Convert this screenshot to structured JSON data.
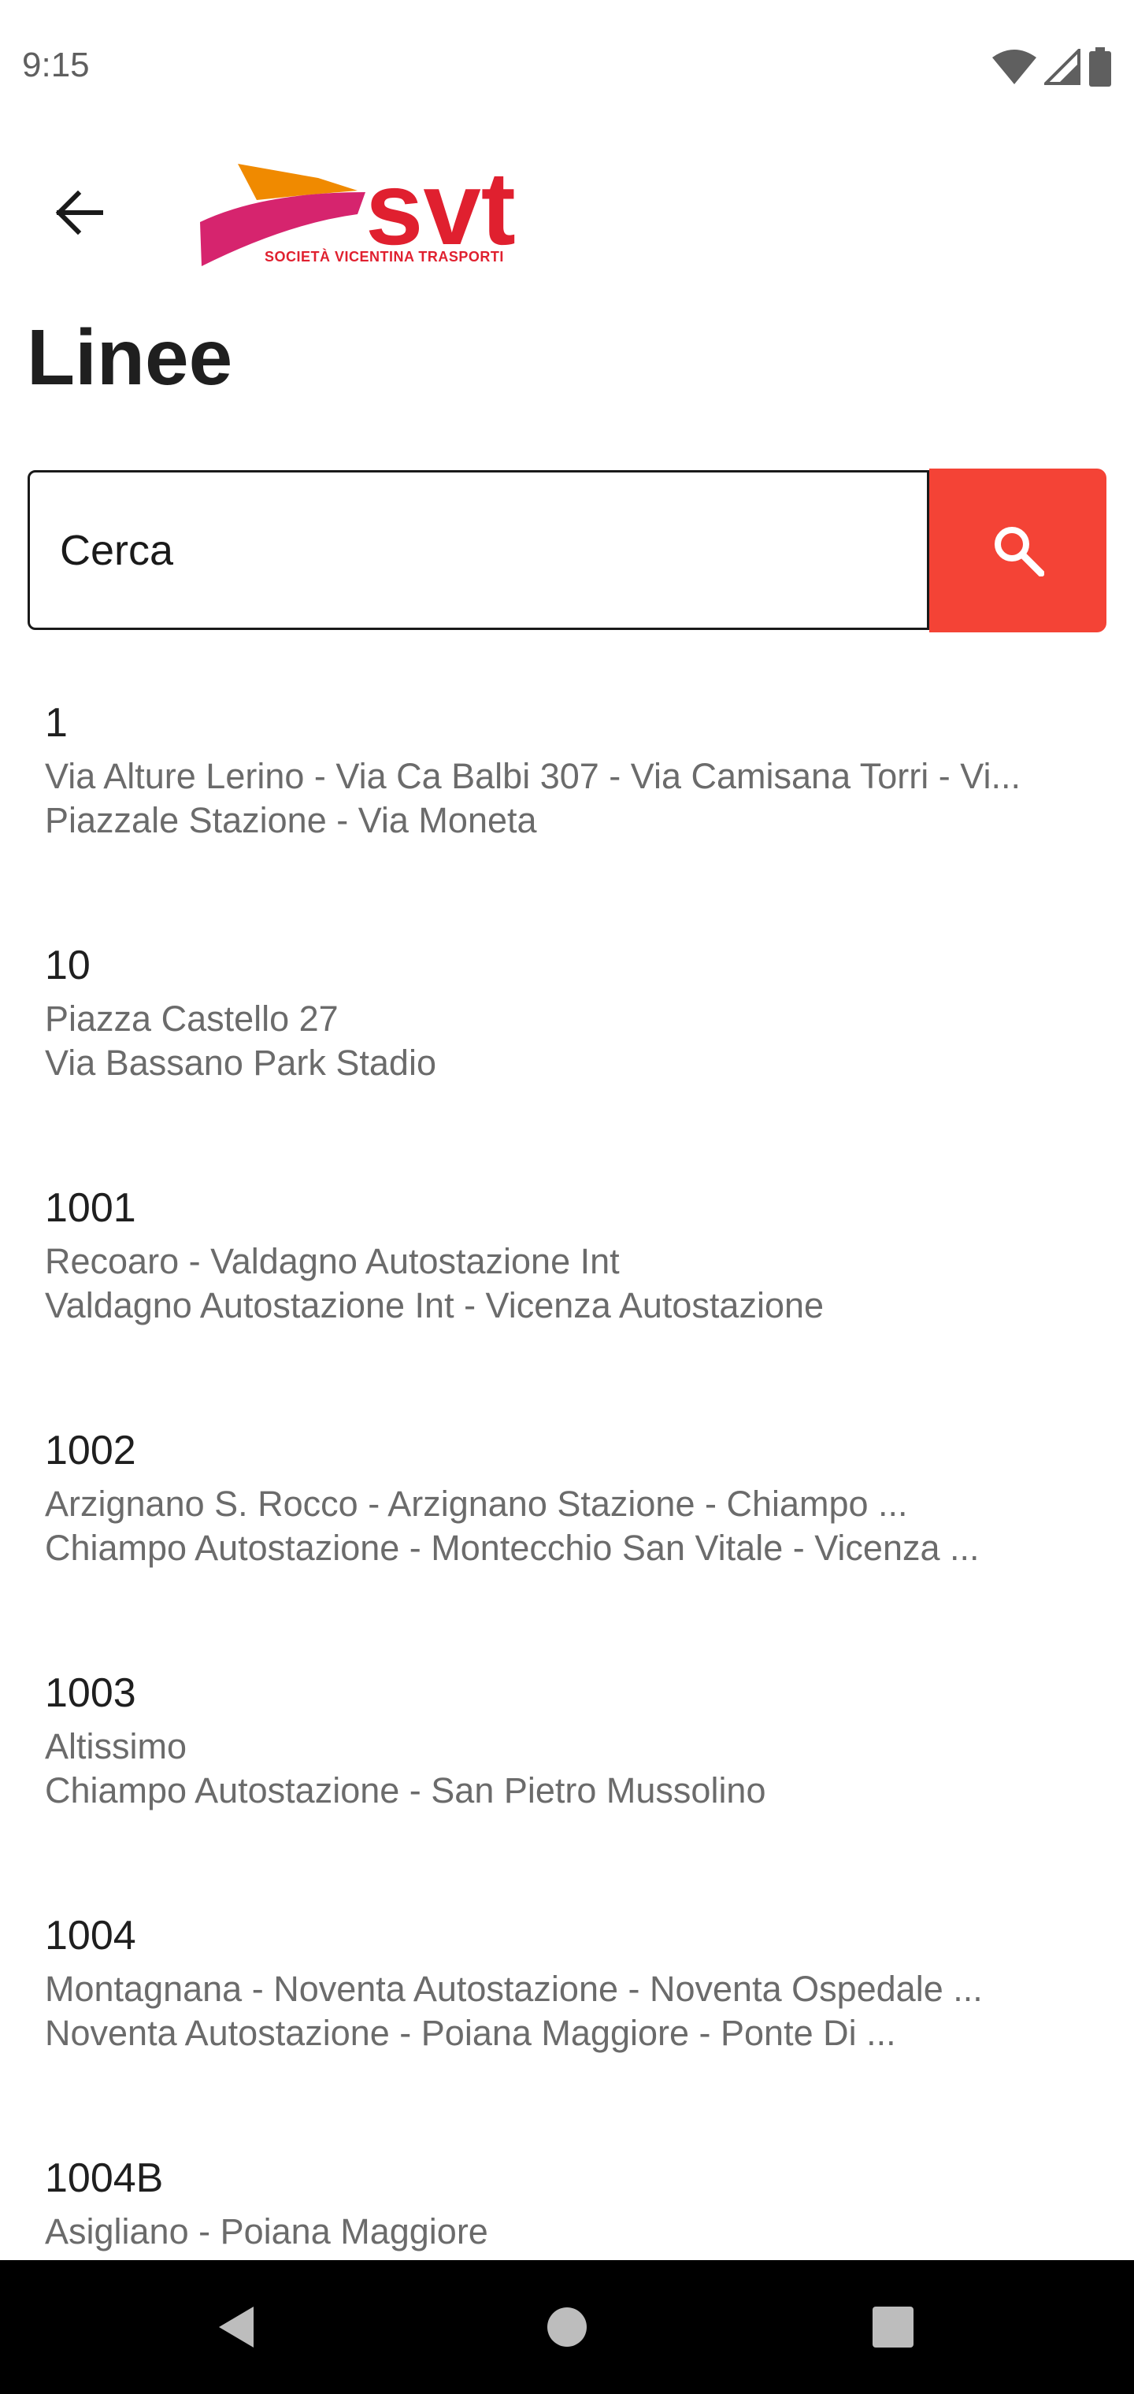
{
  "status_bar": {
    "time": "9:15",
    "icons": [
      "wifi-icon",
      "cell-signal-icon",
      "battery-icon"
    ]
  },
  "header": {
    "back_icon": "arrow-left-icon",
    "logo_text": "svt",
    "logo_subtitle": "SOCIETÀ VICENTINA TRASPORTI"
  },
  "page_title": "Linee",
  "search": {
    "placeholder": "Cerca",
    "value": "",
    "button_icon": "search-icon"
  },
  "colors": {
    "accent": "#f44336",
    "brand_red": "#e0202f",
    "brand_orange": "#f08a00",
    "brand_magenta": "#d6246e",
    "secondary_text": "#6b6b6b"
  },
  "lines": [
    {
      "number": "1",
      "route_a": "Via Alture Lerino - Via Ca Balbi 307 - Via Camisana Torri - Vi...",
      "route_b": "Piazzale Stazione - Via Moneta"
    },
    {
      "number": "10",
      "route_a": "Piazza Castello 27",
      "route_b": "Via Bassano Park Stadio"
    },
    {
      "number": "1001",
      "route_a": "Recoaro - Valdagno Autostazione Int",
      "route_b": "Valdagno Autostazione Int - Vicenza Autostazione"
    },
    {
      "number": "1002",
      "route_a": "Arzignano S. Rocco - Arzignano Stazione - Chiampo ...",
      "route_b": "Chiampo Autostazione - Montecchio San Vitale - Vicenza ..."
    },
    {
      "number": "1003",
      "route_a": "Altissimo",
      "route_b": "Chiampo Autostazione - San Pietro Mussolino"
    },
    {
      "number": "1004",
      "route_a": "Montagnana - Noventa  Autostazione - Noventa Ospedale ...",
      "route_b": "Noventa  Autostazione - Poiana Maggiore - Ponte Di ..."
    },
    {
      "number": "1004B",
      "route_a": "Asigliano - Poiana Maggiore",
      "route_b": ""
    }
  ],
  "nav_bar": [
    "back-nav-icon",
    "home-nav-icon",
    "recents-nav-icon"
  ]
}
